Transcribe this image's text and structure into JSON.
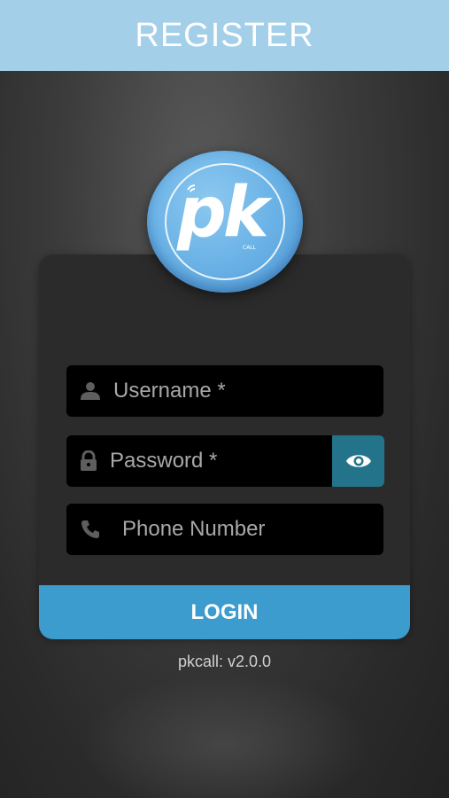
{
  "header": {
    "title": "REGISTER"
  },
  "logo": {
    "text": "pk",
    "subtext": "CALL"
  },
  "form": {
    "username": {
      "placeholder": "Username *",
      "value": "",
      "icon": "user-icon"
    },
    "password": {
      "placeholder": "Password *",
      "value": "",
      "icon": "lock-icon",
      "toggle_icon": "eye-icon"
    },
    "phone": {
      "placeholder": "Phone Number",
      "value": "",
      "icon": "phone-icon"
    }
  },
  "login_button": {
    "label": "LOGIN"
  },
  "footer": {
    "version": "pkcall: v2.0.0"
  },
  "colors": {
    "header_bg": "#a3cfe8",
    "accent": "#3b9ccd",
    "eye_button": "#23748a",
    "field_bg": "#000000"
  }
}
